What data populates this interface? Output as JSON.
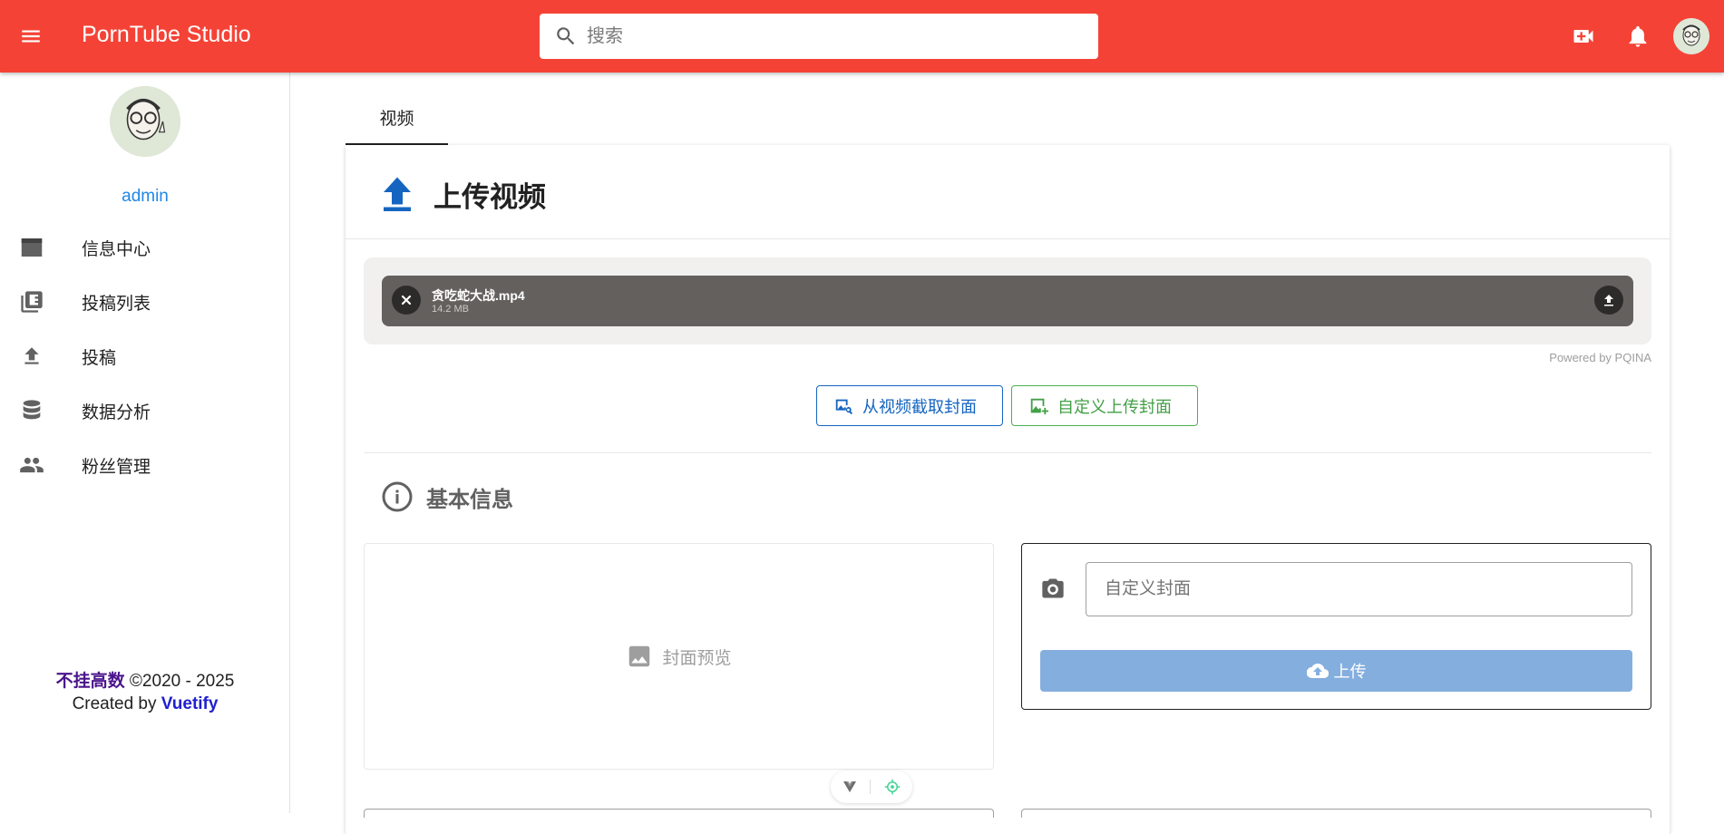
{
  "appbar": {
    "title": "PornTube Studio",
    "search_placeholder": "搜索",
    "icons": [
      "menu-icon",
      "search-icon",
      "video-plus-icon",
      "bell-icon",
      "avatar"
    ]
  },
  "sidebar": {
    "username": "admin",
    "items": [
      {
        "label": "信息中心",
        "icon": "dashboard-icon"
      },
      {
        "label": "投稿列表",
        "icon": "video-library-icon"
      },
      {
        "label": "投稿",
        "icon": "upload-icon"
      },
      {
        "label": "数据分析",
        "icon": "database-icon"
      },
      {
        "label": "粉丝管理",
        "icon": "people-icon"
      }
    ],
    "footer": {
      "brand": "不挂高数",
      "copyright": " ©2020 - 2025",
      "created_by": "Created by ",
      "framework": "Vuetify"
    }
  },
  "tabs": [
    {
      "label": "视频"
    }
  ],
  "card": {
    "title": "上传视频",
    "file": {
      "name": "贪吃蛇大战.mp4",
      "size": "14.2 MB"
    },
    "credit": "Powered by PQINA",
    "capture_cover_label": "从视频截取封面",
    "custom_cover_label": "自定义上传封面",
    "section_title": "基本信息",
    "preview_label": "封面预览",
    "cover_input_placeholder": "自定义封面",
    "upload_label": "上传"
  },
  "colors": {
    "appbar": "#f44336",
    "primary": "#1565c0",
    "success": "#43a047",
    "upload_button": "#84aede"
  }
}
